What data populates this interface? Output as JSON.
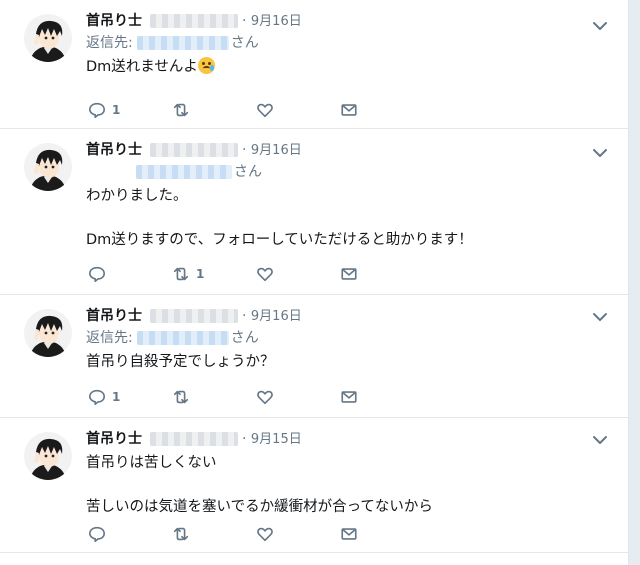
{
  "tweets": [
    {
      "name": "首吊り士",
      "date": "9月16日",
      "reply_label": "返信先:",
      "reply_suffix": "さん",
      "text": "Dm送れませんよ",
      "has_emoji": true,
      "reply_count": "1",
      "retweet_count": ""
    },
    {
      "name": "首吊り士",
      "date": "9月16日",
      "reply_label": "",
      "reply_suffix": "さん",
      "text_lines": [
        "わかりました。",
        "",
        "Dm送りますので、フォローしていただけると助かります！"
      ],
      "reply_count": "",
      "retweet_count": "1"
    },
    {
      "name": "首吊り士",
      "date": "9月16日",
      "reply_label": "返信先:",
      "reply_suffix": "さん",
      "text": "首吊り自殺予定でしょうか？",
      "reply_count": "1",
      "retweet_count": ""
    },
    {
      "name": "首吊り士",
      "date": "9月15日",
      "text_lines": [
        "首吊りは苦しくない",
        "",
        "苦しいのは気道を塞いでるか緩衝材が合ってないから"
      ],
      "reply_count": "",
      "retweet_count": ""
    }
  ],
  "separator": "·",
  "icons": {
    "reply": "reply-icon",
    "retweet": "retweet-icon",
    "like": "heart-icon",
    "dm": "envelope-icon",
    "caret": "chevron-down-icon"
  },
  "colors": {
    "text": "#14171a",
    "muted": "#657786",
    "border": "#e1e8ed",
    "background": "#e6ecf0"
  }
}
